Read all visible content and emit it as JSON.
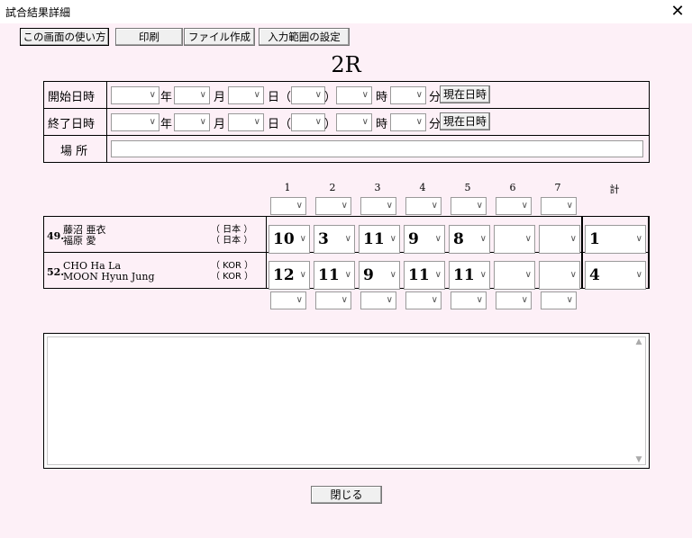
{
  "window": {
    "title": "試合結果詳細",
    "close_glyph": "✕"
  },
  "toolbar": {
    "help_label": "この画面の使い方",
    "print_label": "印刷",
    "file_label": "ファイル作成",
    "range_label": "入力範囲の設定"
  },
  "round": "2R",
  "schedule": {
    "start_label": "開始日時",
    "end_label": "終了日時",
    "place_label": "場 所",
    "year": "年",
    "month": "月",
    "day_open": "日（",
    "day_close": "）",
    "hour": "時",
    "minute": "分",
    "now_button": "現在日時"
  },
  "games": {
    "columns": [
      "1",
      "2",
      "3",
      "4",
      "5",
      "6",
      "7"
    ],
    "total_label": "計"
  },
  "players": [
    {
      "num": "49.",
      "name1": "藤沼 亜衣",
      "name2": "福原 愛",
      "country1": "（ 日本 ）",
      "country2": "（ 日本 ）",
      "scores": [
        "10",
        "3",
        "11",
        "9",
        "8",
        "",
        ""
      ],
      "total": "1"
    },
    {
      "num": "52.",
      "name1": "CHO Ha La",
      "name2": "MOON Hyun Jung",
      "country1": "（ KOR ）",
      "country2": "（ KOR ）",
      "scores": [
        "12",
        "11",
        "9",
        "11",
        "11",
        "",
        ""
      ],
      "total": "4"
    }
  ],
  "memo": {
    "value": ""
  },
  "footer": {
    "close_label": "閉じる"
  },
  "icons": {
    "dropdown": "chevron-down-icon",
    "close": "close-icon"
  }
}
